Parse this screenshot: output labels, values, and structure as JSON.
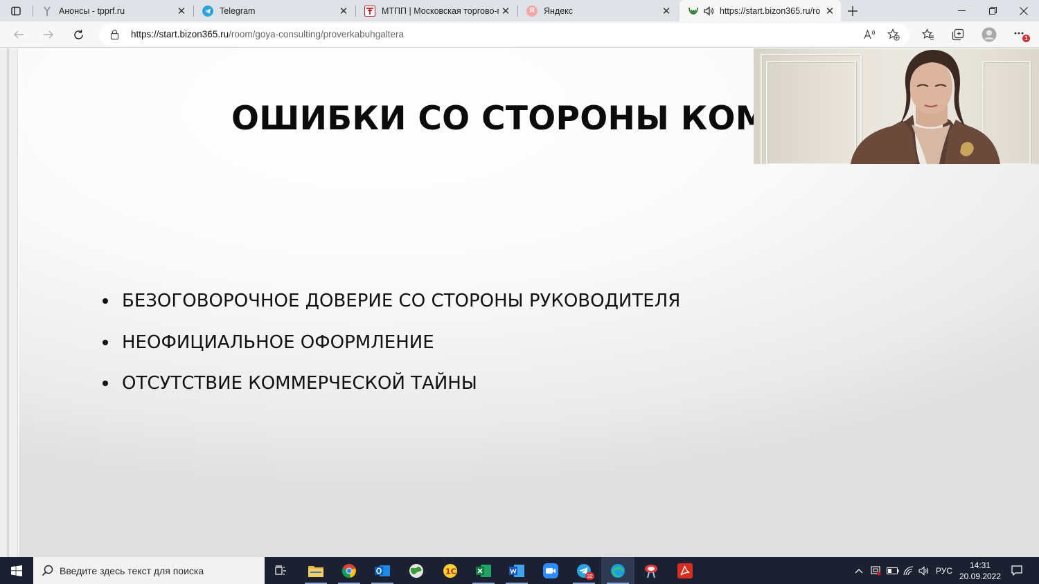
{
  "browser": {
    "tabs": [
      {
        "title": "Анонсы - tpprf.ru",
        "icon": "tpprf-icon"
      },
      {
        "title": "Telegram",
        "icon": "telegram-icon"
      },
      {
        "title": "МТПП | Московская торгово-пр",
        "icon": "mtpp-icon"
      },
      {
        "title": "Яндекс",
        "icon": "yandex-icon"
      },
      {
        "title": "https://start.bizon365.ru/ro",
        "icon": "bizon-icon",
        "active": true
      }
    ],
    "url_host": "https://start.bizon365.ru",
    "url_path": "/room/goya-consulting/proverkabuhgaltera",
    "notification_badge": "1"
  },
  "slide": {
    "title": "ОШИБКИ СО СТОРОНЫ КОМПА",
    "bullets": [
      "БЕЗОГОВОРОЧНОЕ ДОВЕРИЕ СО СТОРОНЫ РУКОВОДИТЕЛЯ",
      "НЕОФИЦИАЛЬНОЕ ОФОРМЛЕНИЕ",
      "ОТСУТСТВИЕ КОММЕРЧЕСКОЙ ТАЙНЫ"
    ]
  },
  "taskbar": {
    "search_placeholder": "Введите здесь текст для поиска",
    "telegram_badge": "32",
    "language": "РУС",
    "time": "14:31",
    "date": "20.09.2022"
  },
  "colors": {
    "tabbar_bg": "#dfe3e8",
    "taskbar_bg": "#1c2131",
    "slide_text": "#0b0b0b",
    "badge_red": "#d13438"
  }
}
